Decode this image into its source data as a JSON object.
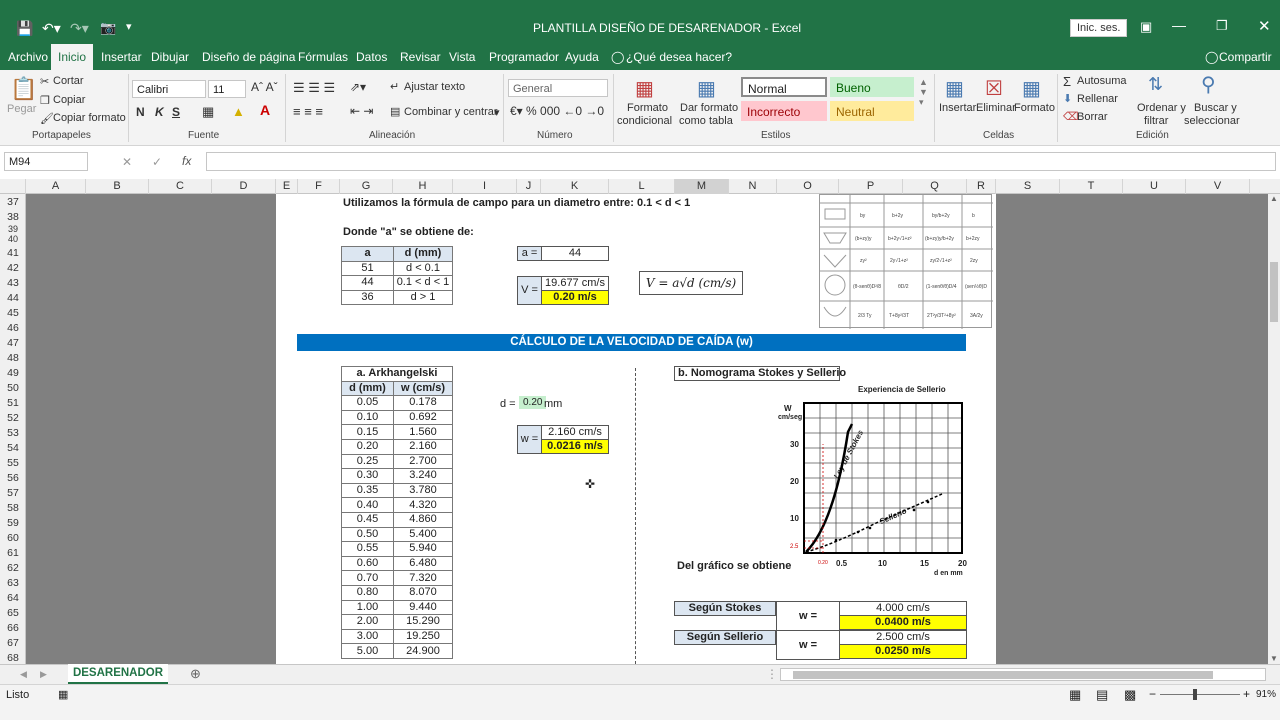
{
  "window": {
    "title": "PLANTILLA DISEÑO DE DESARENADOR  -  Excel",
    "signin": "Inic. ses."
  },
  "menu": {
    "items": [
      "Archivo",
      "Inicio",
      "Insertar",
      "Dibujar",
      "Diseño de página",
      "Fórmulas",
      "Datos",
      "Revisar",
      "Vista",
      "Programador",
      "Ayuda"
    ],
    "tellme": "¿Qué desea hacer?",
    "share": "Compartir"
  },
  "ribbon": {
    "paste": "Pegar",
    "cut": "Cortar",
    "copy": "Copiar",
    "format_painter": "Copiar formato",
    "clipboard_group": "Portapapeles",
    "font_name": "Calibri",
    "font_size": "11",
    "bold": "N",
    "italic": "K",
    "underline": "S",
    "font_group": "Fuente",
    "wrap": "Ajustar texto",
    "merge": "Combinar y centrar",
    "align_group": "Alineación",
    "number_format": "General",
    "number_group": "Número",
    "cond_format_1": "Formato",
    "cond_format_2": "condicional",
    "table_format_1": "Dar formato",
    "table_format_2": "como tabla",
    "style_normal": "Normal",
    "style_bueno": "Bueno",
    "style_incorrecto": "Incorrecto",
    "style_neutral": "Neutral",
    "styles_group": "Estilos",
    "insert": "Insertar",
    "delete": "Eliminar",
    "format": "Formato",
    "cells_group": "Celdas",
    "autosum": "Autosuma",
    "fill": "Rellenar",
    "clear": "Borrar",
    "sort_1": "Ordenar y",
    "sort_2": "filtrar",
    "find_1": "Buscar y",
    "find_2": "seleccionar",
    "editing_group": "Edición"
  },
  "formula_bar": {
    "name_box": "M94",
    "fx": "fx",
    "value": ""
  },
  "columns": [
    "A",
    "B",
    "C",
    "D",
    "E",
    "F",
    "G",
    "H",
    "I",
    "J",
    "K",
    "L",
    "M",
    "N",
    "O",
    "P",
    "Q",
    "R",
    "S",
    "T",
    "U",
    "V"
  ],
  "rows": [
    "37",
    "38",
    "39",
    "40",
    "41",
    "42",
    "43",
    "44",
    "45",
    "46",
    "47",
    "48",
    "49",
    "50",
    "51",
    "52",
    "53",
    "54",
    "55",
    "56",
    "57",
    "58",
    "59",
    "60",
    "61",
    "62",
    "63",
    "64",
    "65",
    "66",
    "67",
    "68"
  ],
  "sheet": {
    "intro": "Utilizamos la fórmula de campo para un diametro entre:  0.1 < d < 1",
    "donde": "Donde \"a\" se obtiene de:",
    "a_table": {
      "headers": [
        "a",
        "d (mm)"
      ],
      "rows": [
        [
          "51",
          "d < 0.1"
        ],
        [
          "44",
          "0.1 < d < 1"
        ],
        [
          "36",
          "d > 1"
        ]
      ]
    },
    "a_label": "a =",
    "a_value": "44",
    "v_label": "V =",
    "v_cms": "19.677 cm/s",
    "v_ms": "0.20 m/s",
    "formula": "V = a√d  (cm/s)",
    "section_title": "CÁLCULO DE LA VELOCIDAD DE CAÍDA (w)",
    "ark_title": "a. Arkhangelski",
    "ark_headers": [
      "d (mm)",
      "w (cm/s)"
    ],
    "ark_rows": [
      [
        "0.05",
        "0.178"
      ],
      [
        "0.10",
        "0.692"
      ],
      [
        "0.15",
        "1.560"
      ],
      [
        "0.20",
        "2.160"
      ],
      [
        "0.25",
        "2.700"
      ],
      [
        "0.30",
        "3.240"
      ],
      [
        "0.35",
        "3.780"
      ],
      [
        "0.40",
        "4.320"
      ],
      [
        "0.45",
        "4.860"
      ],
      [
        "0.50",
        "5.400"
      ],
      [
        "0.55",
        "5.940"
      ],
      [
        "0.60",
        "6.480"
      ],
      [
        "0.70",
        "7.320"
      ],
      [
        "0.80",
        "8.070"
      ],
      [
        "1.00",
        "9.440"
      ],
      [
        "2.00",
        "15.290"
      ],
      [
        "3.00",
        "19.250"
      ],
      [
        "5.00",
        "24.900"
      ]
    ],
    "d_label": "d =",
    "d_value": "0.20",
    "d_unit": "mm",
    "w_label": "w =",
    "w_cms": "2.160 cm/s",
    "w_ms": "0.0216 m/s",
    "nomo_title": "b. Nomograma Stokes y Sellerio",
    "chart_title": "Experiencia de Sellerio",
    "chart_ylabel_1": "W",
    "chart_ylabel_2": "cm/seg",
    "chart_yticks": [
      "30",
      "20",
      "10",
      "2.5"
    ],
    "chart_xticks": [
      "0.20",
      "0.5",
      "10",
      "15",
      "20"
    ],
    "chart_xlabel": "d en mm",
    "curve_stokes": "Ley de Stokes",
    "curve_sellerio": "Sellerio",
    "del_grafico": "Del gráfico se obtiene",
    "stokes_label": "Según Stokes",
    "stokes_w": "w =",
    "stokes_cms": "4.000 cm/s",
    "stokes_ms": "0.0400 m/s",
    "sellerio_label": "Según Sellerio",
    "sellerio_w": "w =",
    "sellerio_cms": "2.500 cm/s",
    "sellerio_ms": "0.0250 m/s"
  },
  "sheet_tab": "DESARENADOR",
  "status": {
    "ready": "Listo",
    "zoom": "91%"
  }
}
